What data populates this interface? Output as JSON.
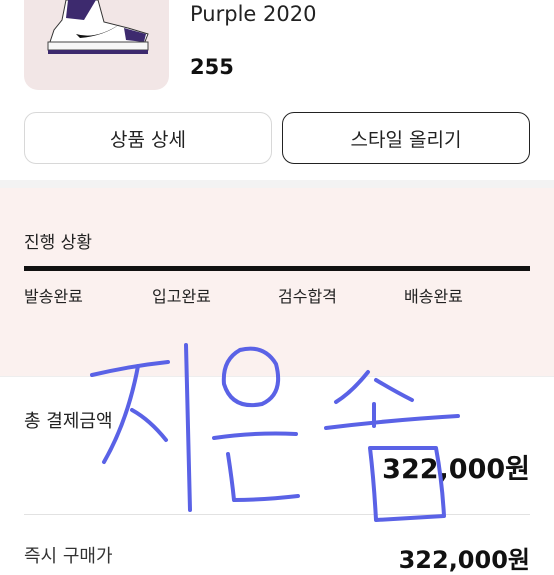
{
  "product": {
    "name": "Purple 2020",
    "size": "255"
  },
  "buttons": {
    "detail_label": "상품 상세",
    "style_label": "스타일 올리기"
  },
  "progress": {
    "title": "진행 상황",
    "steps": [
      "발송완료",
      "입고완료",
      "검수합격",
      "배송완료"
    ],
    "progress_fraction": 1.0
  },
  "payment": {
    "total_label": "총 결제금액",
    "total_amount": "322,000원",
    "instant_label": "즉시 구매가",
    "instant_amount": "322,000원"
  },
  "colors": {
    "progress_bg": "#fbf1ef",
    "handwriting_ink": "#5a62e6",
    "accent_dark": "#111111"
  }
}
